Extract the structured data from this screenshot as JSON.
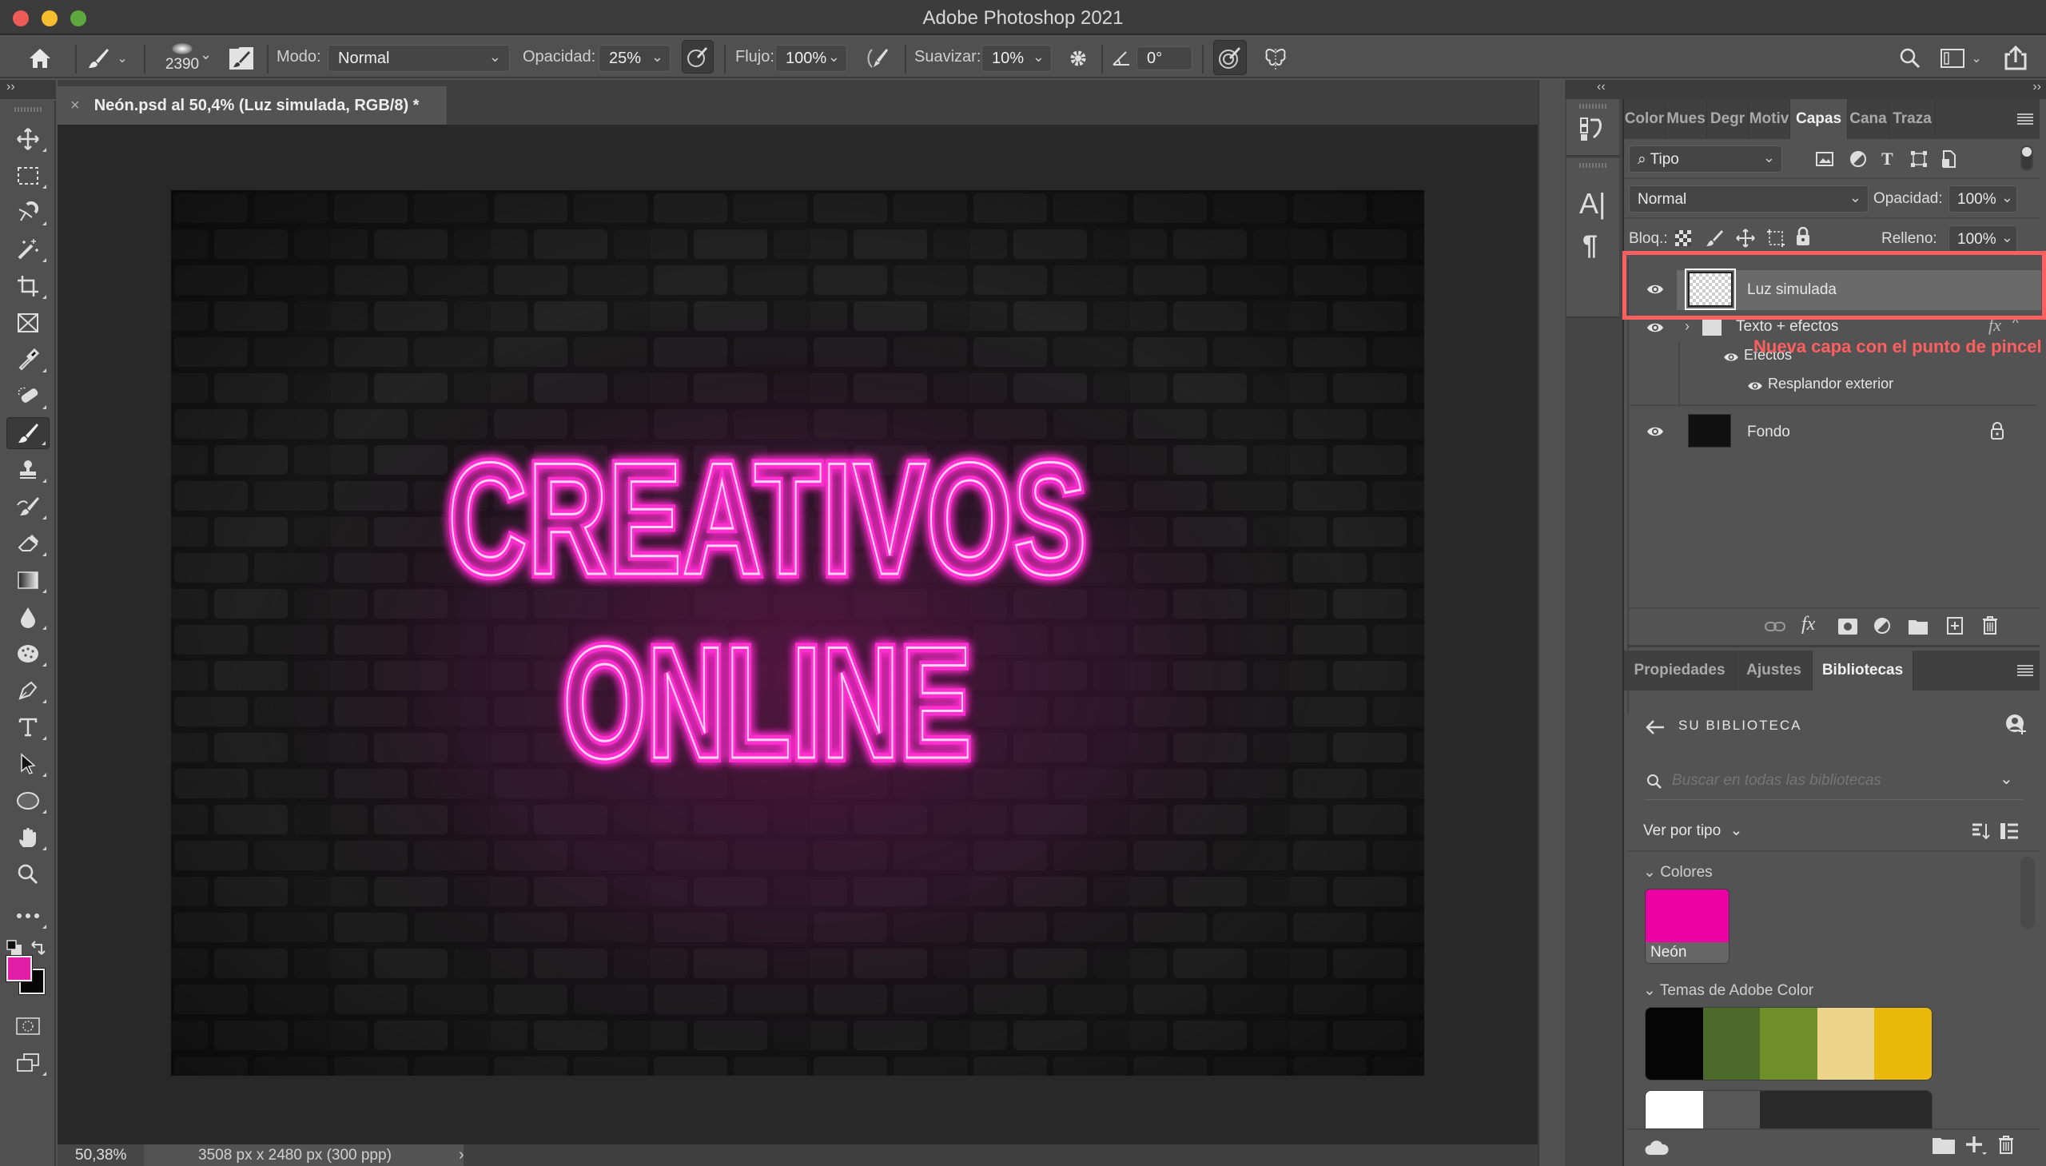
{
  "window": {
    "title": "Adobe Photoshop 2021",
    "traffic_lights": {
      "close": "#ee5c57",
      "minimize": "#f6be2f",
      "zoom": "#5ea83e"
    }
  },
  "options_bar": {
    "brush_size": "2390",
    "mode_label": "Modo:",
    "mode_value": "Normal",
    "opacity_label": "Opacidad:",
    "opacity_value": "25%",
    "flow_label": "Flujo:",
    "flow_value": "100%",
    "smoothing_label": "Suavizar:",
    "smoothing_value": "10%",
    "angle_value": "0°"
  },
  "document": {
    "tab_title": "Neón.psd al 50,4% (Luz simulada, RGB/8) *",
    "canvas_text_line1": "CREATIVOS",
    "canvas_text_line2": "ONLINE",
    "neon_color": "#ff2ecf"
  },
  "status_bar": {
    "zoom": "50,38%",
    "doc_info": "3508 px x 2480 px (300 ppp)",
    "arrow": "›"
  },
  "tools": {
    "foreground_color": "#e21ea8",
    "background_color": "#060606"
  },
  "layers_panel": {
    "tabs": [
      {
        "label": "Color",
        "active": false
      },
      {
        "label": "Mues",
        "active": false
      },
      {
        "label": "Degr",
        "active": false
      },
      {
        "label": "Motiv",
        "active": false
      },
      {
        "label": "Capas",
        "active": true
      },
      {
        "label": "Cana",
        "active": false
      },
      {
        "label": "Traza",
        "active": false
      }
    ],
    "filter_value": "Tipo",
    "blend_mode": "Normal",
    "opacity_label": "Opacidad:",
    "opacity_value": "100%",
    "lock_label": "Bloq.:",
    "fill_label": "Relleno:",
    "fill_value": "100%",
    "layers": [
      {
        "name": "Luz simulada",
        "visible": true,
        "selected": true
      },
      {
        "name": "Texto + efectos",
        "visible": true,
        "type": "group",
        "fx": "fx"
      },
      {
        "name": "Efectos",
        "visible": true,
        "type": "effects"
      },
      {
        "name": "Resplandor exterior",
        "visible": true,
        "type": "effect"
      },
      {
        "name": "Fondo",
        "visible": true,
        "locked": true
      }
    ],
    "annotation": "Nueva capa con el punto de pincel",
    "annotation_color": "#ff5f5f"
  },
  "libraries_panel": {
    "tabs": [
      {
        "label": "Propiedades",
        "active": false
      },
      {
        "label": "Ajustes",
        "active": false
      },
      {
        "label": "Bibliotecas",
        "active": true
      }
    ],
    "header": "SU BIBLIOTECA",
    "search_placeholder": "Buscar en todas las bibliotecas",
    "view_by": "Ver por tipo",
    "colors_section": "Colores",
    "color_swatch": {
      "name": "Neón",
      "hex": "#ec00a4"
    },
    "themes_section": "Temas de Adobe Color",
    "theme1": [
      "#050505",
      "#4c6b2a",
      "#6e8f2a",
      "#ecd48a",
      "#e8b90a"
    ],
    "theme2": [
      "#ffffff",
      "#575757",
      "#2a2a2a"
    ]
  }
}
